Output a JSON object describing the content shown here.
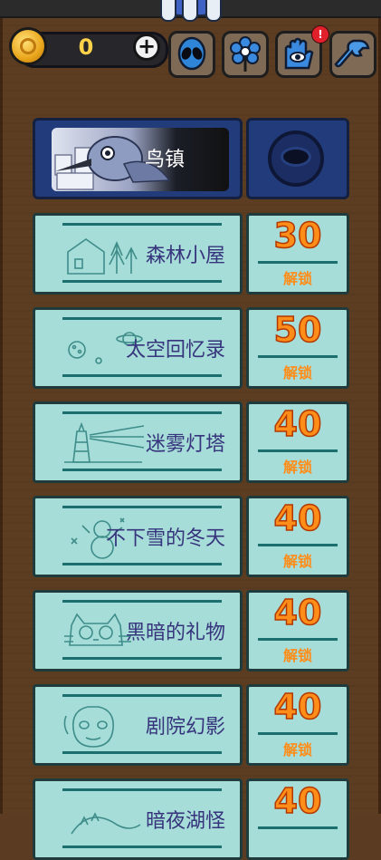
{
  "hud": {
    "coins": "0",
    "add_symbol": "+",
    "notification_badge": "!",
    "icons": [
      "alien-icon",
      "flower-icon",
      "eye-hand-icon",
      "wrench-icon"
    ]
  },
  "featured": {
    "name": "鸟镇"
  },
  "levels": [
    {
      "name": "森林小屋",
      "price": "30",
      "unlock": "解锁"
    },
    {
      "name": "太空回忆录",
      "price": "50",
      "unlock": "解锁"
    },
    {
      "name": "迷雾灯塔",
      "price": "40",
      "unlock": "解锁"
    },
    {
      "name": "不下雪的冬天",
      "price": "40",
      "unlock": "解锁"
    },
    {
      "name": "黑暗的礼物",
      "price": "40",
      "unlock": "解锁"
    },
    {
      "name": "剧院幻影",
      "price": "40",
      "unlock": "解锁"
    },
    {
      "name": "暗夜湖怪",
      "price": "40",
      "unlock": ""
    }
  ],
  "colors": {
    "wood": "#5b3c22",
    "ticket": "#a7ddd8",
    "featured": "#223b7a",
    "price": "#ff8d1a",
    "label": "#36347c"
  }
}
